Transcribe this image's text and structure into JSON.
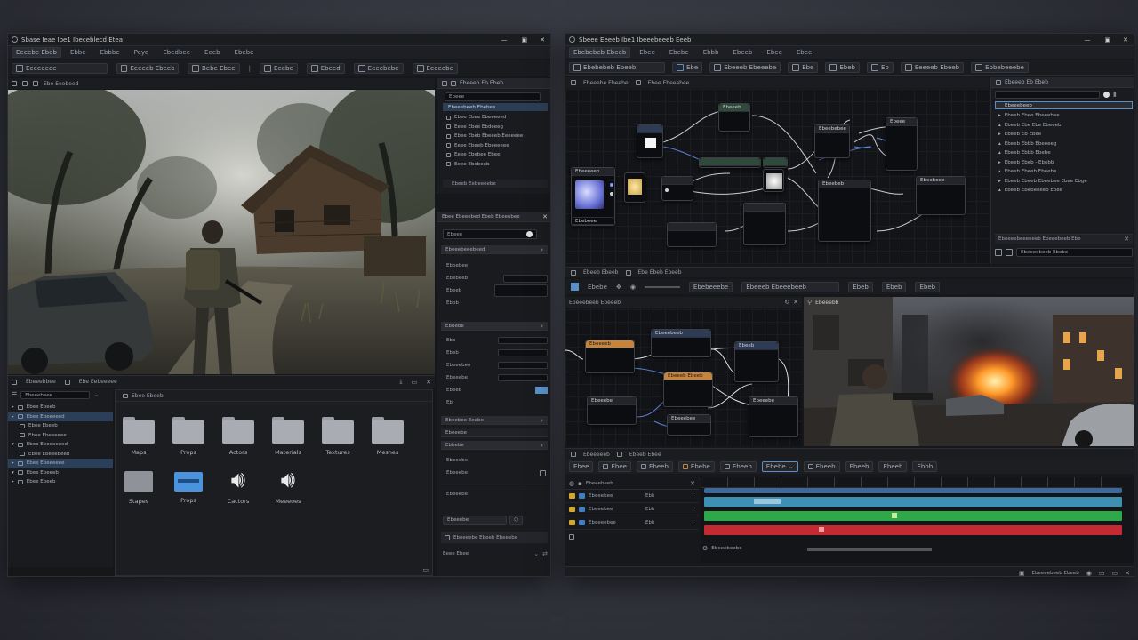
{
  "left": {
    "title": "Sbase Ieae Ibe1 Ibeceblecd Etea",
    "menu": [
      "Eeeebe Ebeb",
      "Ebbe",
      "Ebbbe",
      "Peye",
      "Ebedbee",
      "Eeeb",
      "Ebebe"
    ],
    "toolbar": [
      "Eeeeeeee",
      "Eeeeeb Ebeebd",
      "Bebe Ebee",
      "Eeebe",
      "Ebeed",
      "Eeeebebe",
      "Eeeeebe"
    ],
    "viewport_tabs": [
      "Ebe Eeebeed"
    ],
    "outliner": {
      "search_placeholder": "Ebeee",
      "header": "Ebeeebeeb Ebebee",
      "items": [
        "Ebee Ebee Ebeeeeed",
        "Eeee Ebee Ebdeeeg",
        "Ebee Ebeb Ebeeeb Eeeeeee",
        "Eeee Ebeeb Ebeeeeee",
        "Eeee Ebebee Ebee",
        "Eeee Ebebeeb"
      ],
      "footer": "Ebeeb Eebeeeebe"
    },
    "details": {
      "title": "Ebee Ebeeebed Ebeb Ebeeebee",
      "search_placeholder": "Ebeee",
      "sections": [
        "Ebeeebeeebeed",
        "Ebbebe",
        "Ebeebee Eeebe",
        "Ebeeebe",
        "Ebbebe"
      ],
      "labels": [
        "Ebbebee",
        "Ebebeeb",
        "Ebeeb",
        "Ebbb",
        "Ebb",
        "Ebeb",
        "Ebeeebee",
        "Ebeeebe",
        "Ebeeb",
        "Eb"
      ],
      "bottom_buttons": [
        "Ebeeeebe Ebeeb Ebeeebe",
        "Eeee Ebee"
      ],
      "bottom_labels": [
        "Ebeeebe",
        "Ebeeebe"
      ]
    },
    "content_browser": {
      "tabs": [
        "Ebeeebbee",
        "Ebe Eebeeeee"
      ],
      "search_placeholder": "Ebeeebeee",
      "path": "Ebee Ebeeb",
      "tree": [
        "Ebee Ebeeb",
        "Ebee Ebeeeeed",
        "Ebee Ebeeb",
        "Ebee Ebeeeeee",
        "Ebee Ebeeeeeed",
        "Ebee Ebeeebeeb",
        "Ebee Ebeeeeee",
        "Ebee Ebeeeb",
        "Ebee Ebeeb"
      ],
      "assets": [
        "Maps",
        "Props",
        "Actors",
        "Materials",
        "Textures",
        "Meshes",
        "Stapes",
        "Props",
        "Cactors",
        "Meeeoes"
      ]
    }
  },
  "right": {
    "title": "Sbeee Eeeeb Ibe1 Ibeeebeeeb Eeeb",
    "menu": [
      "Ebebebeb Ebeeb",
      "Ebee",
      "Ebebe",
      "Ebbb",
      "Ebeeb",
      "Ebee",
      "Ebee"
    ],
    "toolbar": [
      "Ebebebeb Ebeeb",
      "Ebe",
      "Ebeeeb Ebeeebe",
      "Ebe",
      "Ebeb",
      "Eb",
      "Eeeeeb Ebeeb",
      "Ebbebeeebe"
    ],
    "graph_tabs": [
      "Ebeeebe Ebeebe",
      "Ebee Ebeeebee"
    ],
    "graph_nodes": [
      "Ebeeeeeb",
      "Ebebeee",
      "Ebeeeb",
      "Ebeebebee",
      "Ebeee",
      "Ebeebeb",
      "Ebeebeee"
    ],
    "hierarchy": {
      "title": "Ebeeeb Eb Ebeb",
      "header": "Ebeeebeeb",
      "items": [
        "Ebeeb Ebee Ebeeebee",
        "Ebeeb Ebe Ebe Ebeeeb",
        "Ebeeb Eb Ebee",
        "Ebeeb Ebbb Ebeeeeg",
        "Ebeeb Ebbb Ebebe",
        "Ebeeb Ebeb - Ebebb",
        "Ebeeb Ebeeb Ebeebe",
        "Ebeeb Ebeeb Ebeebee Ebee Ebge",
        "Ebeeb Ebebeeeeb Ebee"
      ],
      "footer_bar": "Ebeeeebeeeeeeb Ebeeebeeb Ebe",
      "footer_text": "Ebeeeebeeb Ebebe"
    },
    "second_tabs": [
      "Ebeeb Ebeeb",
      "Ebe Ebeb Ebeeb"
    ],
    "second_toolbar": [
      "Ebebe",
      "Ebebeeebe",
      "Ebeeeb Ebeeebeeb",
      "Ebeb",
      "Ebeb",
      "Ebeb"
    ],
    "blueprint_title": "Ebeeebeeb Ebeeeb",
    "blueprint_nodes": [
      "Ebeeeeb",
      "Ebeeebeeb",
      "Ebeeb",
      "Ebeeeb Ebeeb",
      "Ebeeebe",
      "Ebeeebee",
      "Ebeeebe"
    ],
    "game_view_title": "Ebeeebb",
    "timeline": {
      "tabs": [
        "Ebeeeeeb",
        "Ebeeb Ebee"
      ],
      "toolbar": [
        "Ebee",
        "Ebee",
        "Ebeeb",
        "Ebebe",
        "Ebeeb",
        "Ebebe",
        "Ebeeb",
        "Ebeeb",
        "Ebeeb",
        "Ebbb"
      ],
      "tracks_header": "Ebeeebeeb",
      "tracks": [
        {
          "name": "Ebeeebee",
          "value": "Ebb"
        },
        {
          "name": "Ebeeebee",
          "value": "Ebb"
        },
        {
          "name": "Ebeeeebee",
          "value": "Ebb"
        }
      ],
      "footer": "Ebeeebeebe",
      "status_bar": "Ebeeeebeeb Ebeeb"
    }
  },
  "colors": {
    "accent_blue": "#5a8fc8",
    "folder_blue": "#4c93dd",
    "track_blue": "#3d8fb3",
    "track_green": "#2fa84a",
    "track_red": "#c42b30",
    "node_orange": "#c8843a"
  }
}
